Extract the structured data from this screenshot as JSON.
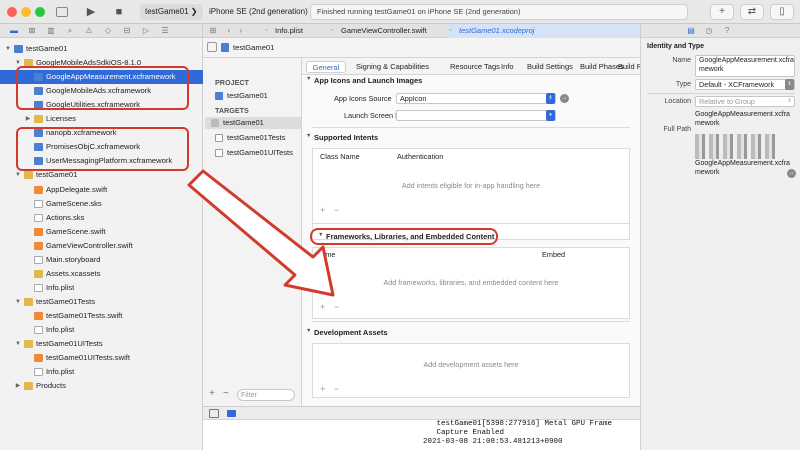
{
  "toolbar": {
    "scheme": "testGame01",
    "device": "iPhone SE (2nd generation)",
    "status": "Finished running testGame01 on iPhone SE (2nd generation)",
    "add_label": "+",
    "swap_label": "⇄"
  },
  "navigator": {
    "rows": [
      {
        "label": "testGame01",
        "indent": 0,
        "icon": "project",
        "tri": "▼",
        "selected": false
      },
      {
        "label": "GoogleMobileAdsSdkiOS-8.1.0",
        "indent": 1,
        "icon": "folder",
        "tri": "▼",
        "selected": false
      },
      {
        "label": "GoogleAppMeasurement.xcframework",
        "indent": 2,
        "icon": "xcframework",
        "tri": "",
        "selected": true
      },
      {
        "label": "GoogleMobileAds.xcframework",
        "indent": 2,
        "icon": "xcframework",
        "tri": "",
        "selected": false
      },
      {
        "label": "GoogleUtilities.xcframework",
        "indent": 2,
        "icon": "xcframework",
        "tri": "",
        "selected": false
      },
      {
        "label": "Licenses",
        "indent": 2,
        "icon": "folder",
        "tri": "▶",
        "selected": false
      },
      {
        "label": "nanopb.xcframework",
        "indent": 2,
        "icon": "xcframework",
        "tri": "",
        "selected": false
      },
      {
        "label": "PromisesObjC.xcframework",
        "indent": 2,
        "icon": "xcframework",
        "tri": "",
        "selected": false
      },
      {
        "label": "UserMessagingPlatform.xcframework",
        "indent": 2,
        "icon": "xcframework",
        "tri": "",
        "selected": false
      },
      {
        "label": "testGame01",
        "indent": 1,
        "icon": "folder",
        "tri": "▼",
        "selected": false
      },
      {
        "label": "AppDelegate.swift",
        "indent": 2,
        "icon": "swift",
        "tri": "",
        "selected": false
      },
      {
        "label": "GameScene.sks",
        "indent": 2,
        "icon": "file",
        "tri": "",
        "selected": false
      },
      {
        "label": "Actions.sks",
        "indent": 2,
        "icon": "file",
        "tri": "",
        "selected": false
      },
      {
        "label": "GameScene.swift",
        "indent": 2,
        "icon": "swift",
        "tri": "",
        "selected": false
      },
      {
        "label": "GameViewController.swift",
        "indent": 2,
        "icon": "swift",
        "tri": "",
        "selected": false
      },
      {
        "label": "Main.storyboard",
        "indent": 2,
        "icon": "file",
        "tri": "",
        "selected": false
      },
      {
        "label": "Assets.xcassets",
        "indent": 2,
        "icon": "assets",
        "tri": "",
        "selected": false
      },
      {
        "label": "Info.plist",
        "indent": 2,
        "icon": "file",
        "tri": "",
        "selected": false
      },
      {
        "label": "testGame01Tests",
        "indent": 1,
        "icon": "folder",
        "tri": "▼",
        "selected": false
      },
      {
        "label": "testGame01Tests.swift",
        "indent": 2,
        "icon": "swift",
        "tri": "",
        "selected": false
      },
      {
        "label": "Info.plist",
        "indent": 2,
        "icon": "file",
        "tri": "",
        "selected": false
      },
      {
        "label": "testGame01UITests",
        "indent": 1,
        "icon": "folder",
        "tri": "▼",
        "selected": false
      },
      {
        "label": "testGame01UITests.swift",
        "indent": 2,
        "icon": "swift",
        "tri": "",
        "selected": false
      },
      {
        "label": "Info.plist",
        "indent": 2,
        "icon": "file",
        "tri": "",
        "selected": false
      },
      {
        "label": "Products",
        "indent": 1,
        "icon": "folder",
        "tri": "▶",
        "selected": false
      }
    ],
    "filter_placeholder": "Filter"
  },
  "tabs": [
    {
      "label": "Info.plist",
      "active": false
    },
    {
      "label": "GameViewController.swift",
      "active": false
    },
    {
      "label": "testGame01.xcodeproj",
      "active": true
    }
  ],
  "jumpbar": {
    "project": "testGame01"
  },
  "targets_panel": {
    "project_header": "PROJECT",
    "project_item": "testGame01",
    "targets_header": "TARGETS",
    "items": [
      "testGame01",
      "testGame01Tests",
      "testGame01UITests"
    ]
  },
  "settings_tabs": [
    "General",
    "Signing & Capabilities",
    "Resource Tags",
    "Info",
    "Build Settings",
    "Build Phases",
    "Build Rules"
  ],
  "sections": {
    "app_icons": {
      "title": "App Icons and Launch Images",
      "icons_source_label": "App Icons Source",
      "icons_source_value": "AppIcon",
      "launch_label": "Launch Screen File",
      "launch_value": ""
    },
    "intents": {
      "title": "Supported Intents",
      "col1": "Class Name",
      "col2": "Authentication",
      "placeholder": "Add intents eligible for in-app handling here"
    },
    "frameworks": {
      "title": "Frameworks, Libraries, and Embedded Content",
      "col1": "Name",
      "col2": "Embed",
      "placeholder": "Add frameworks, libraries, and embedded content here"
    },
    "dev_assets": {
      "title": "Development Assets",
      "placeholder": "Add development assets here"
    }
  },
  "inspector": {
    "section_title": "Identity and Type",
    "name_label": "Name",
    "name_value": "GoogleAppMeasurement.xcframework",
    "type_label": "Type",
    "type_value": "Default - XCFramework",
    "location_label": "Location",
    "location_value": "Relative to Group",
    "location_file": "GoogleAppMeasurement.xcframework",
    "full_path_label": "Full Path",
    "full_path_value": "GoogleAppMeasurement.xcframework"
  },
  "console": {
    "lines": [
      "   testGame01[5398:277916] Metal GPU Frame",
      "   Capture Enabled",
      "2021-03-08 21:08:53.481213+0900"
    ]
  },
  "colors": {
    "accent": "#2f6ad8",
    "annotation": "#d23b2b"
  }
}
